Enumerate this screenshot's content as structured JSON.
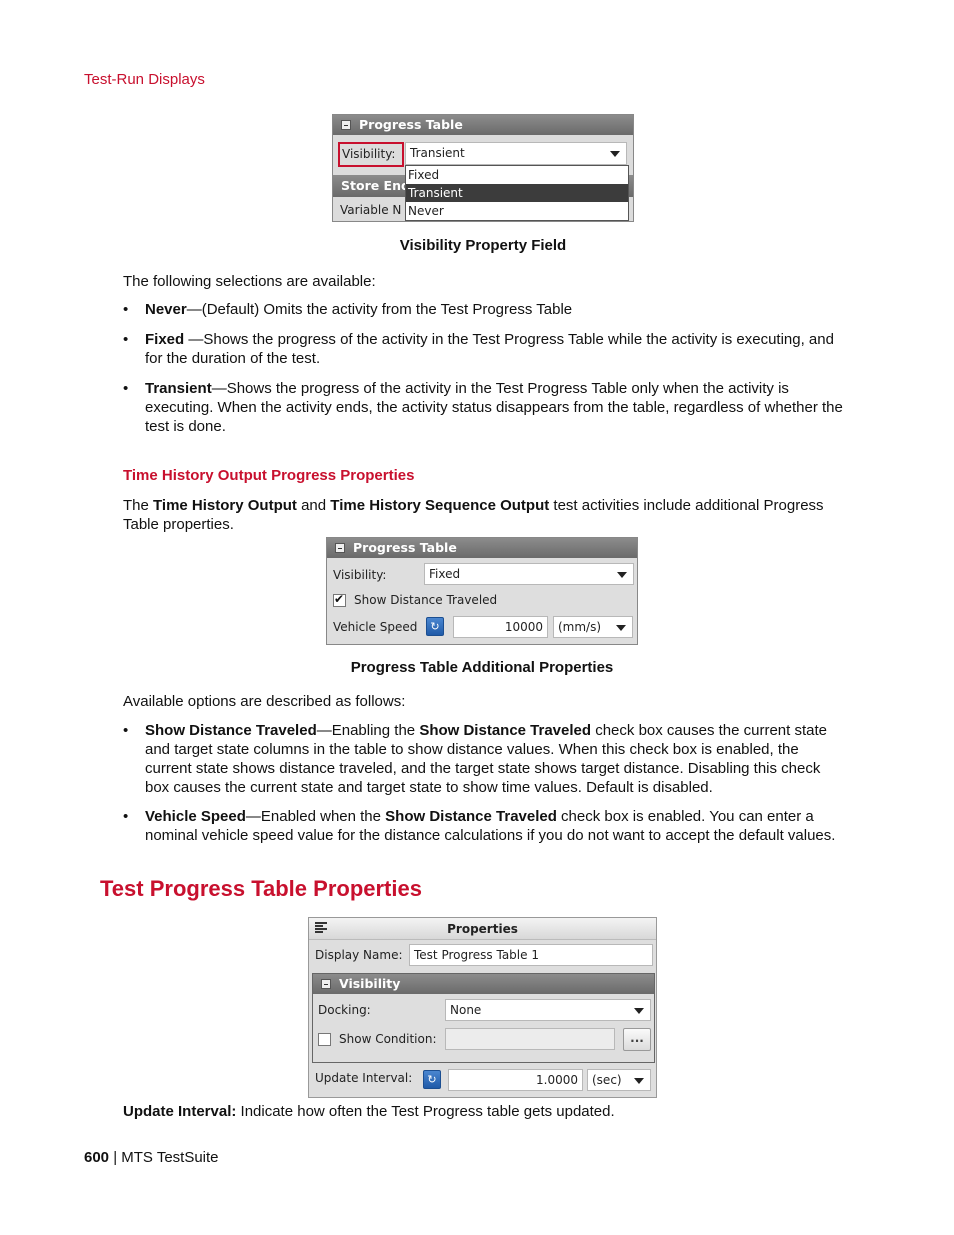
{
  "page": {
    "running_header": "Test-Run Displays",
    "footer": {
      "page_number": "600",
      "separator": " | ",
      "product": "MTS TestSuite"
    }
  },
  "figure1": {
    "panel_title": "Progress Table",
    "visibility_label": "Visibility:",
    "visibility_value": "Transient",
    "dropdown_options": [
      {
        "label": "Fixed",
        "selected": false
      },
      {
        "label": "Transient",
        "selected": true
      },
      {
        "label": "Never",
        "selected": false
      }
    ],
    "obscured_section_title": "Store End",
    "obscured_label": "Variable N",
    "highlight_color": "#c8102e",
    "caption": "Visibility Property Field"
  },
  "section1": {
    "intro": "The following selections are available:",
    "bullets": [
      {
        "term": "Never",
        "text": "—(Default) Omits the activity from the Test Progress Table"
      },
      {
        "term": "Fixed",
        "text": " —Shows the progress of the activity in the Test Progress Table while the activity is executing, and for the duration of the test."
      },
      {
        "term": "Transient",
        "text": "—Shows the progress of the activity in the Test Progress Table only when the activity is executing. When the activity ends, the activity status disappears from the table, regardless of whether the test is done."
      }
    ]
  },
  "section2": {
    "heading": "Time History Output Progress Properties",
    "intro_parts": [
      {
        "text": "The ",
        "bold": false
      },
      {
        "text": "Time History Output",
        "bold": true
      },
      {
        "text": " and ",
        "bold": false
      },
      {
        "text": "Time History Sequence Output",
        "bold": true
      },
      {
        "text": " test activities include additional Progress Table properties.",
        "bold": false
      }
    ]
  },
  "figure2": {
    "panel_title": "Progress Table",
    "visibility_label": "Visibility:",
    "visibility_value": "Fixed",
    "show_distance_label": "Show Distance Traveled",
    "show_distance_checked": true,
    "vehicle_speed_label": "Vehicle Speed",
    "vehicle_speed_value": "10000",
    "vehicle_speed_unit": "(mm/s)",
    "caption": "Progress Table Additional Properties"
  },
  "section3": {
    "intro": "Available options are described as follows:",
    "bullets": [
      {
        "parts": [
          {
            "text": "Show Distance Traveled",
            "bold": true
          },
          {
            "text": "—Enabling the ",
            "bold": false
          },
          {
            "text": "Show Distance Traveled",
            "bold": true
          },
          {
            "text": " check box causes the current state and target state columns in the table to show distance values. When this check box is enabled, the current state shows distance traveled, and the target state shows target distance. Disabling this check box causes the current state and target state to show time values. Default is disabled.",
            "bold": false
          }
        ]
      },
      {
        "parts": [
          {
            "text": "Vehicle Speed",
            "bold": true
          },
          {
            "text": "—Enabled when the ",
            "bold": false
          },
          {
            "text": "Show Distance Traveled",
            "bold": true
          },
          {
            "text": " check box is enabled. You can enter a nominal vehicle speed value for the distance calculations if you do not want to accept the default values.",
            "bold": false
          }
        ]
      }
    ]
  },
  "section4": {
    "heading": "Test Progress Table Properties",
    "update_interval_term": "Update Interval:",
    "update_interval_text": " Indicate how often the Test Progress table gets updated."
  },
  "figure3": {
    "title": "Properties",
    "display_name_label": "Display Name:",
    "display_name_value": "Test Progress Table 1",
    "visibility_group_title": "Visibility",
    "docking_label": "Docking:",
    "docking_value": "None",
    "show_condition_label": "Show Condition:",
    "show_condition_checked": false,
    "show_condition_value": "",
    "ellipsis_label": "...",
    "update_interval_label": "Update Interval:",
    "update_interval_value": "1.0000",
    "update_interval_unit": "(sec)"
  }
}
